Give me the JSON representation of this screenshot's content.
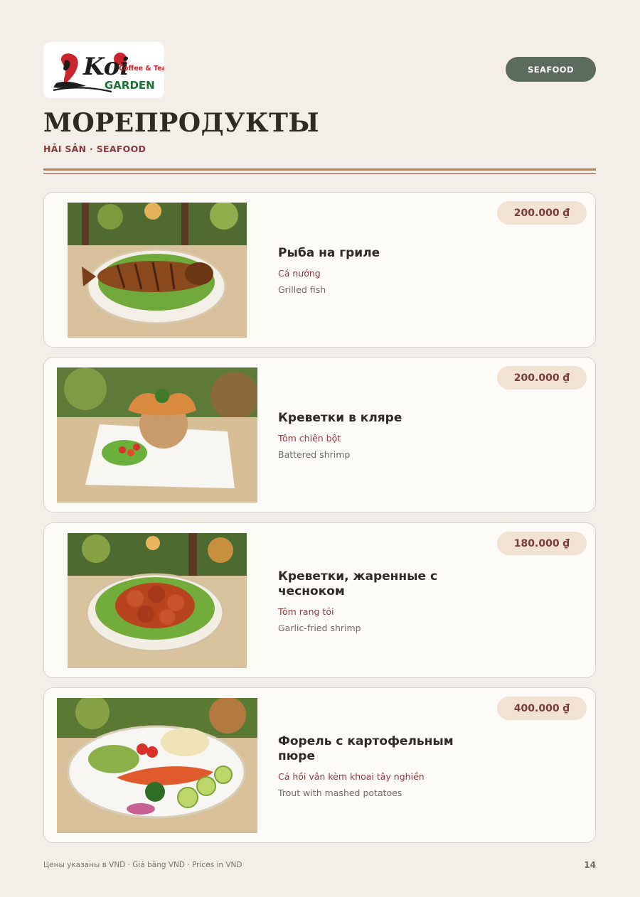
{
  "logo": {
    "brand_script": "Koi",
    "tagline": "Coffee & Tea",
    "name": "GARDEN"
  },
  "category_badge": "SEAFOOD",
  "page_title": "МОРЕПРОДУКТЫ",
  "page_subtitle": "HẢI SẢN · SEAFOOD",
  "items": [
    {
      "name_ru": "Рыба на гриле",
      "name_vi": "Cá nướng",
      "name_en": "Grilled fish",
      "price": "200.000 ₫",
      "image_icon": "grilled-fish-photo"
    },
    {
      "name_ru": "Креветки в кляре",
      "name_vi": "Tôm chiên bột",
      "name_en": "Battered shrimp",
      "price": "200.000 ₫",
      "image_icon": "battered-shrimp-photo"
    },
    {
      "name_ru": "Креветки, жаренные с чесноком",
      "name_vi": "Tôm rang tỏi",
      "name_en": "Garlic-fried shrimp",
      "price": "180.000 ₫",
      "image_icon": "garlic-shrimp-photo"
    },
    {
      "name_ru": "Форель с картофельным пюре",
      "name_vi": "Cá hồi vân kèm khoai tây nghiền",
      "name_en": "Trout with mashed potatoes",
      "price": "400.000 ₫",
      "image_icon": "trout-mashed-potatoes-photo"
    }
  ],
  "footer": {
    "note": "Цены указаны в VND · Giá bằng VND · Prices in VND",
    "page_number": "14"
  },
  "colors": {
    "background": "#f3eee7",
    "card": "#fdfbf8",
    "badge": "#5b6b5c",
    "accent_red": "#8a3a3c",
    "price_pill": "#f1e2d2",
    "rule_gold": "#b98445"
  }
}
